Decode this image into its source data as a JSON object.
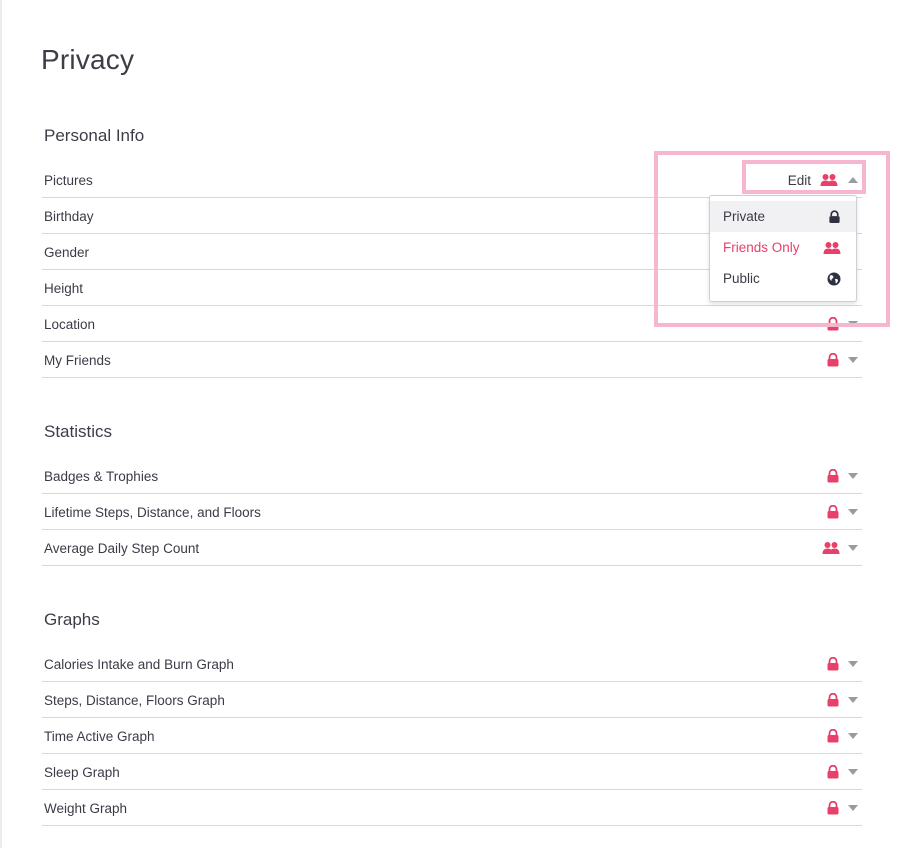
{
  "page": {
    "title": "Privacy"
  },
  "colors": {
    "accent": "#e8406a",
    "text": "#3b3b47",
    "divider": "#d9d9d9",
    "highlight": "#f6b6d0"
  },
  "sections": [
    {
      "title": "Personal Info",
      "items": [
        {
          "label": "Pictures",
          "setting": "friends",
          "edit_label": "Edit",
          "open": true
        },
        {
          "label": "Birthday",
          "setting": ""
        },
        {
          "label": "Gender",
          "setting": ""
        },
        {
          "label": "Height",
          "setting": ""
        },
        {
          "label": "Location",
          "setting": "private"
        },
        {
          "label": "My Friends",
          "setting": "private"
        }
      ]
    },
    {
      "title": "Statistics",
      "items": [
        {
          "label": "Badges & Trophies",
          "setting": "private"
        },
        {
          "label": "Lifetime Steps, Distance, and Floors",
          "setting": "private"
        },
        {
          "label": "Average Daily Step Count",
          "setting": "friends"
        }
      ]
    },
    {
      "title": "Graphs",
      "items": [
        {
          "label": "Calories Intake and Burn Graph",
          "setting": "private"
        },
        {
          "label": "Steps, Distance, Floors Graph",
          "setting": "private"
        },
        {
          "label": "Time Active Graph",
          "setting": "private"
        },
        {
          "label": "Sleep Graph",
          "setting": "private"
        },
        {
          "label": "Weight Graph",
          "setting": "private"
        }
      ]
    }
  ],
  "dropdown": {
    "options": [
      {
        "label": "Private",
        "icon": "lock-icon",
        "selected": true
      },
      {
        "label": "Friends Only",
        "icon": "friends-icon"
      },
      {
        "label": "Public",
        "icon": "globe-icon"
      }
    ]
  }
}
